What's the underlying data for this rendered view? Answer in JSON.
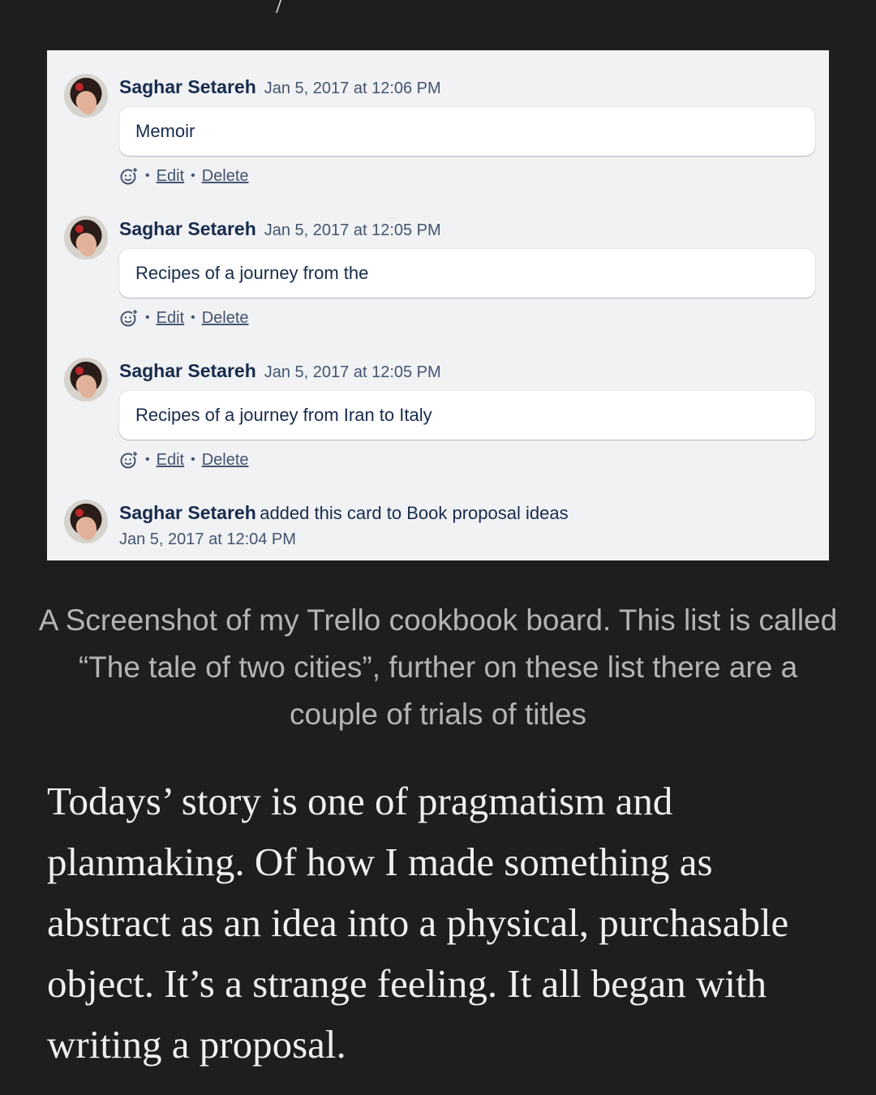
{
  "top_fragment": "/",
  "trello": {
    "comments": [
      {
        "author": "Saghar Setareh",
        "timestamp": "Jan 5, 2017 at 12:06 PM",
        "text": "Memoir",
        "edit_label": "Edit",
        "delete_label": "Delete",
        "separator": "•"
      },
      {
        "author": "Saghar Setareh",
        "timestamp": "Jan 5, 2017 at 12:05 PM",
        "text": "Recipes of a journey from the",
        "edit_label": "Edit",
        "delete_label": "Delete",
        "separator": "•"
      },
      {
        "author": "Saghar Setareh",
        "timestamp": "Jan 5, 2017 at 12:05 PM",
        "text": "Recipes of a journey from Iran to Italy",
        "edit_label": "Edit",
        "delete_label": "Delete",
        "separator": "•"
      }
    ],
    "activity": {
      "author": "Saghar Setareh",
      "action": "added this card to Book proposal ideas",
      "timestamp": "Jan 5, 2017 at 12:04 PM"
    }
  },
  "caption": "A Screenshot of my Trello cookbook board. This list is called “The tale of two cities”, further on these list there are a couple of trials of titles",
  "body_paragraph": "Todays’ story is one of pragmatism and planmaking. Of how I made something as abstract as an idea into a physical, purchasable object. It’s a strange feeling. It all began with writing a proposal."
}
